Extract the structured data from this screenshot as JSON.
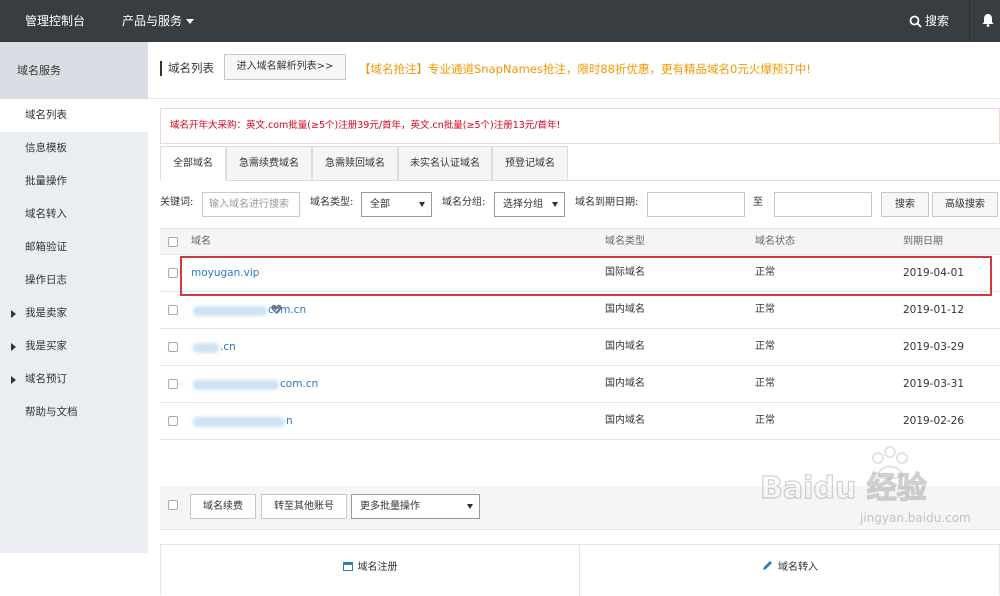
{
  "topbar": {
    "brand": "管理控制台",
    "products": "产品与服务",
    "search": "搜索"
  },
  "sidebar": {
    "header": "域名服务",
    "items": [
      {
        "label": "域名列表",
        "expandable": false,
        "active": true
      },
      {
        "label": "信息模板",
        "expandable": false
      },
      {
        "label": "批量操作",
        "expandable": false
      },
      {
        "label": "域名转入",
        "expandable": false
      },
      {
        "label": "邮箱验证",
        "expandable": false
      },
      {
        "label": "操作日志",
        "expandable": false
      },
      {
        "label": "我是卖家",
        "expandable": true
      },
      {
        "label": "我是买家",
        "expandable": true
      },
      {
        "label": "域名预订",
        "expandable": true
      },
      {
        "label": "帮助与文档",
        "expandable": false
      }
    ]
  },
  "header": {
    "title": "域名列表",
    "dns_button": "进入域名解析列表>>",
    "promo": "【域名抢注】专业通道SnapNames抢注，限时88折优惠，更有精品域名0元火爆预订中!"
  },
  "notice": "域名开年大采购：英文.com批量(≥5个)注册39元/首年，英文.cn批量(≥5个)注册13元/首年!",
  "tabs": [
    "全部域名",
    "急需续费域名",
    "急需赎回域名",
    "未实名认证域名",
    "预登记域名"
  ],
  "filters": {
    "keyword_label": "关键词:",
    "keyword_placeholder": "输入域名进行搜索",
    "type_label": "域名类型:",
    "type_value": "全部",
    "group_label": "域名分组:",
    "group_value": "选择分组",
    "expiry_label": "域名到期日期:",
    "to_label": "至",
    "search_button": "搜索",
    "advanced_button": "高级搜索"
  },
  "table": {
    "columns": [
      "域名",
      "域名类型",
      "域名状态",
      "到期日期"
    ],
    "rows": [
      {
        "name": "moyugan.vip",
        "type": "国际域名",
        "status": "正常",
        "date": "2019-04-01"
      },
      {
        "name": "com.cn",
        "type": "国内域名",
        "status": "正常",
        "date": "2019-01-12"
      },
      {
        "name": ".cn",
        "type": "国内域名",
        "status": "正常",
        "date": "2019-03-29"
      },
      {
        "name": "com.cn",
        "type": "国内域名",
        "status": "正常",
        "date": "2019-03-31"
      },
      {
        "name": "n",
        "type": "国内域名",
        "status": "正常",
        "date": "2019-02-26"
      }
    ]
  },
  "footer": {
    "renew_button": "域名续费",
    "transfer_button": "转至其他账号",
    "more_select": "更多批量操作"
  },
  "cards": {
    "register": "域名注册",
    "transfer_in": "域名转入"
  },
  "watermark": {
    "logo": "Baidu 经验",
    "url": "jingyan.baidu.com"
  },
  "colors": {
    "topbar": "#373d41",
    "sidebar": "#eaedf1",
    "promo": "#f39800",
    "notice": "#d9001b",
    "link": "#2a7bc4",
    "highlight": "#d0393e"
  }
}
